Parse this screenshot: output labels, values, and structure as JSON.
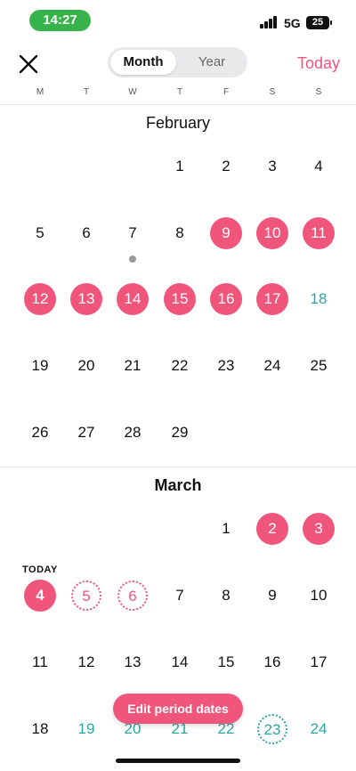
{
  "status_bar": {
    "time": "14:27",
    "network": "5G",
    "battery": "25"
  },
  "header": {
    "close_icon": "close-x-icon",
    "tabs": [
      {
        "label": "Month",
        "selected": true
      },
      {
        "label": "Year",
        "selected": false
      }
    ],
    "today_label": "Today"
  },
  "weekdays": [
    "M",
    "T",
    "W",
    "T",
    "F",
    "S",
    "S"
  ],
  "months": {
    "february": {
      "title": "February",
      "days": [
        {
          "d": "1",
          "col": 3,
          "row": 0
        },
        {
          "d": "2",
          "col": 4,
          "row": 0
        },
        {
          "d": "3",
          "col": 5,
          "row": 0
        },
        {
          "d": "4",
          "col": 6,
          "row": 0
        },
        {
          "d": "5",
          "col": 0,
          "row": 1
        },
        {
          "d": "6",
          "col": 1,
          "row": 1
        },
        {
          "d": "7",
          "col": 2,
          "row": 1,
          "marker": true
        },
        {
          "d": "8",
          "col": 3,
          "row": 1
        },
        {
          "d": "9",
          "col": 4,
          "row": 1,
          "type": "period"
        },
        {
          "d": "10",
          "col": 5,
          "row": 1,
          "type": "period"
        },
        {
          "d": "11",
          "col": 6,
          "row": 1,
          "type": "period"
        },
        {
          "d": "12",
          "col": 0,
          "row": 2,
          "type": "period"
        },
        {
          "d": "13",
          "col": 1,
          "row": 2,
          "type": "period"
        },
        {
          "d": "14",
          "col": 2,
          "row": 2,
          "type": "period"
        },
        {
          "d": "15",
          "col": 3,
          "row": 2,
          "type": "period"
        },
        {
          "d": "16",
          "col": 4,
          "row": 2,
          "type": "period"
        },
        {
          "d": "17",
          "col": 5,
          "row": 2,
          "type": "period"
        },
        {
          "d": "18",
          "col": 6,
          "row": 2,
          "type": "fertile"
        },
        {
          "d": "19",
          "col": 0,
          "row": 3
        },
        {
          "d": "20",
          "col": 1,
          "row": 3
        },
        {
          "d": "21",
          "col": 2,
          "row": 3
        },
        {
          "d": "22",
          "col": 3,
          "row": 3
        },
        {
          "d": "23",
          "col": 4,
          "row": 3
        },
        {
          "d": "24",
          "col": 5,
          "row": 3
        },
        {
          "d": "25",
          "col": 6,
          "row": 3
        },
        {
          "d": "26",
          "col": 0,
          "row": 4
        },
        {
          "d": "27",
          "col": 1,
          "row": 4
        },
        {
          "d": "28",
          "col": 2,
          "row": 4
        },
        {
          "d": "29",
          "col": 3,
          "row": 4
        }
      ]
    },
    "march": {
      "title": "March",
      "today_label": "TODAY",
      "days": [
        {
          "d": "1",
          "col": 4,
          "row": 0
        },
        {
          "d": "2",
          "col": 5,
          "row": 0,
          "type": "period"
        },
        {
          "d": "3",
          "col": 6,
          "row": 0,
          "type": "period"
        },
        {
          "d": "4",
          "col": 0,
          "row": 1,
          "type": "today"
        },
        {
          "d": "5",
          "col": 1,
          "row": 1,
          "type": "predicted"
        },
        {
          "d": "6",
          "col": 2,
          "row": 1,
          "type": "predicted"
        },
        {
          "d": "7",
          "col": 3,
          "row": 1
        },
        {
          "d": "8",
          "col": 4,
          "row": 1
        },
        {
          "d": "9",
          "col": 5,
          "row": 1
        },
        {
          "d": "10",
          "col": 6,
          "row": 1
        },
        {
          "d": "11",
          "col": 0,
          "row": 2
        },
        {
          "d": "12",
          "col": 1,
          "row": 2
        },
        {
          "d": "13",
          "col": 2,
          "row": 2
        },
        {
          "d": "14",
          "col": 3,
          "row": 2
        },
        {
          "d": "15",
          "col": 4,
          "row": 2
        },
        {
          "d": "16",
          "col": 5,
          "row": 2
        },
        {
          "d": "17",
          "col": 6,
          "row": 2
        },
        {
          "d": "18",
          "col": 0,
          "row": 3
        },
        {
          "d": "19",
          "col": 1,
          "row": 3,
          "type": "fertile"
        },
        {
          "d": "20",
          "col": 2,
          "row": 3,
          "type": "fertile"
        },
        {
          "d": "21",
          "col": 3,
          "row": 3,
          "type": "fertile"
        },
        {
          "d": "22",
          "col": 4,
          "row": 3,
          "type": "fertile"
        },
        {
          "d": "23",
          "col": 5,
          "row": 3,
          "type": "ovulation"
        },
        {
          "d": "24",
          "col": 6,
          "row": 3,
          "type": "fertile"
        }
      ]
    }
  },
  "edit_button": {
    "label": "Edit period dates"
  },
  "colors": {
    "period": "#f0567c",
    "fertile": "#2aa6a6",
    "status_pill": "#36b34a"
  }
}
